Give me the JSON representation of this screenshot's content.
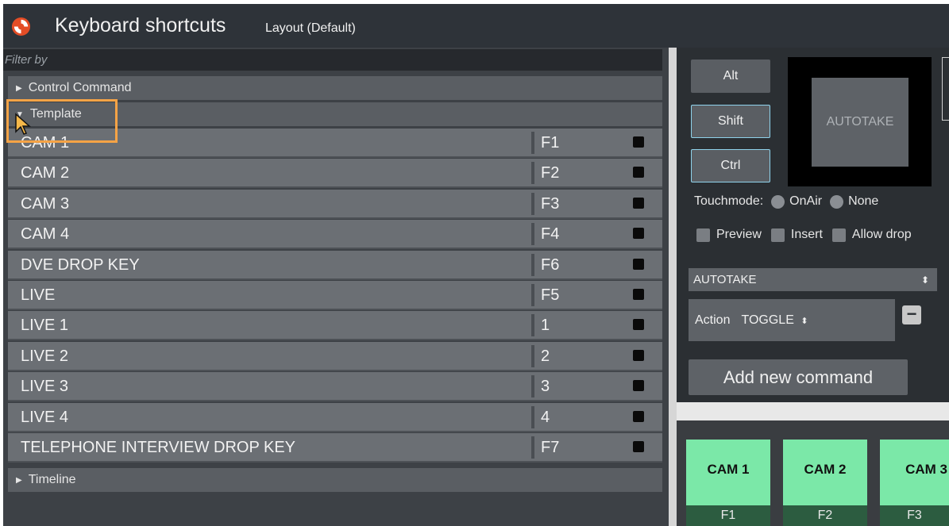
{
  "header": {
    "title": "Keyboard shortcuts",
    "layout_label": "Layout (Default)"
  },
  "filter": {
    "placeholder": "Filter by"
  },
  "groups": {
    "control_command": "Control Command",
    "template": "Template",
    "timeline": "Timeline"
  },
  "shortcuts": [
    {
      "name": "CAM 1",
      "key": "F1"
    },
    {
      "name": "CAM 2",
      "key": "F2"
    },
    {
      "name": "CAM 3",
      "key": "F3"
    },
    {
      "name": "CAM 4",
      "key": "F4"
    },
    {
      "name": "DVE DROP KEY",
      "key": "F6"
    },
    {
      "name": "LIVE",
      "key": "F5"
    },
    {
      "name": "LIVE 1",
      "key": "1"
    },
    {
      "name": "LIVE 2",
      "key": "2"
    },
    {
      "name": "LIVE 3",
      "key": "3"
    },
    {
      "name": "LIVE 4",
      "key": "4"
    },
    {
      "name": "TELEPHONE INTERVIEW DROP KEY",
      "key": "F7"
    }
  ],
  "modifiers": {
    "alt": "Alt",
    "shift": "Shift",
    "ctrl": "Ctrl"
  },
  "preview_tile": "AUTOTAKE",
  "touchmode": {
    "label": "Touchmode:",
    "onair": "OnAir",
    "none": "None"
  },
  "options": {
    "preview": "Preview",
    "insert": "Insert",
    "allow_drop": "Allow drop"
  },
  "command_select": "AUTOTAKE",
  "action": {
    "label": "Action",
    "value": "TOGGLE"
  },
  "add_command": "Add new command",
  "buttons": [
    {
      "label": "CAM 1",
      "key": "F1"
    },
    {
      "label": "CAM 2",
      "key": "F2"
    },
    {
      "label": "CAM 3",
      "key": "F3"
    }
  ],
  "colors": {
    "accent_highlight": "#f5a346",
    "cam_button": "#7be8a8",
    "cam_key_bar": "#2c5c40"
  }
}
